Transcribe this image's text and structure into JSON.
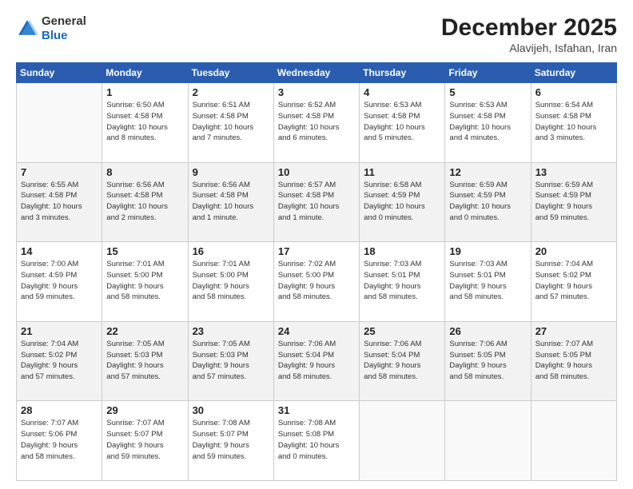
{
  "header": {
    "logo_general": "General",
    "logo_blue": "Blue",
    "main_title": "December 2025",
    "subtitle": "Alavijeh, Isfahan, Iran"
  },
  "weekdays": [
    "Sunday",
    "Monday",
    "Tuesday",
    "Wednesday",
    "Thursday",
    "Friday",
    "Saturday"
  ],
  "rows": [
    {
      "shade": "white",
      "cells": [
        {
          "day": "",
          "info": ""
        },
        {
          "day": "1",
          "info": "Sunrise: 6:50 AM\nSunset: 4:58 PM\nDaylight: 10 hours\nand 8 minutes."
        },
        {
          "day": "2",
          "info": "Sunrise: 6:51 AM\nSunset: 4:58 PM\nDaylight: 10 hours\nand 7 minutes."
        },
        {
          "day": "3",
          "info": "Sunrise: 6:52 AM\nSunset: 4:58 PM\nDaylight: 10 hours\nand 6 minutes."
        },
        {
          "day": "4",
          "info": "Sunrise: 6:53 AM\nSunset: 4:58 PM\nDaylight: 10 hours\nand 5 minutes."
        },
        {
          "day": "5",
          "info": "Sunrise: 6:53 AM\nSunset: 4:58 PM\nDaylight: 10 hours\nand 4 minutes."
        },
        {
          "day": "6",
          "info": "Sunrise: 6:54 AM\nSunset: 4:58 PM\nDaylight: 10 hours\nand 3 minutes."
        }
      ]
    },
    {
      "shade": "shaded",
      "cells": [
        {
          "day": "7",
          "info": "Sunrise: 6:55 AM\nSunset: 4:58 PM\nDaylight: 10 hours\nand 3 minutes."
        },
        {
          "day": "8",
          "info": "Sunrise: 6:56 AM\nSunset: 4:58 PM\nDaylight: 10 hours\nand 2 minutes."
        },
        {
          "day": "9",
          "info": "Sunrise: 6:56 AM\nSunset: 4:58 PM\nDaylight: 10 hours\nand 1 minute."
        },
        {
          "day": "10",
          "info": "Sunrise: 6:57 AM\nSunset: 4:58 PM\nDaylight: 10 hours\nand 1 minute."
        },
        {
          "day": "11",
          "info": "Sunrise: 6:58 AM\nSunset: 4:59 PM\nDaylight: 10 hours\nand 0 minutes."
        },
        {
          "day": "12",
          "info": "Sunrise: 6:59 AM\nSunset: 4:59 PM\nDaylight: 10 hours\nand 0 minutes."
        },
        {
          "day": "13",
          "info": "Sunrise: 6:59 AM\nSunset: 4:59 PM\nDaylight: 9 hours\nand 59 minutes."
        }
      ]
    },
    {
      "shade": "white",
      "cells": [
        {
          "day": "14",
          "info": "Sunrise: 7:00 AM\nSunset: 4:59 PM\nDaylight: 9 hours\nand 59 minutes."
        },
        {
          "day": "15",
          "info": "Sunrise: 7:01 AM\nSunset: 5:00 PM\nDaylight: 9 hours\nand 58 minutes."
        },
        {
          "day": "16",
          "info": "Sunrise: 7:01 AM\nSunset: 5:00 PM\nDaylight: 9 hours\nand 58 minutes."
        },
        {
          "day": "17",
          "info": "Sunrise: 7:02 AM\nSunset: 5:00 PM\nDaylight: 9 hours\nand 58 minutes."
        },
        {
          "day": "18",
          "info": "Sunrise: 7:03 AM\nSunset: 5:01 PM\nDaylight: 9 hours\nand 58 minutes."
        },
        {
          "day": "19",
          "info": "Sunrise: 7:03 AM\nSunset: 5:01 PM\nDaylight: 9 hours\nand 58 minutes."
        },
        {
          "day": "20",
          "info": "Sunrise: 7:04 AM\nSunset: 5:02 PM\nDaylight: 9 hours\nand 57 minutes."
        }
      ]
    },
    {
      "shade": "shaded",
      "cells": [
        {
          "day": "21",
          "info": "Sunrise: 7:04 AM\nSunset: 5:02 PM\nDaylight: 9 hours\nand 57 minutes."
        },
        {
          "day": "22",
          "info": "Sunrise: 7:05 AM\nSunset: 5:03 PM\nDaylight: 9 hours\nand 57 minutes."
        },
        {
          "day": "23",
          "info": "Sunrise: 7:05 AM\nSunset: 5:03 PM\nDaylight: 9 hours\nand 57 minutes."
        },
        {
          "day": "24",
          "info": "Sunrise: 7:06 AM\nSunset: 5:04 PM\nDaylight: 9 hours\nand 58 minutes."
        },
        {
          "day": "25",
          "info": "Sunrise: 7:06 AM\nSunset: 5:04 PM\nDaylight: 9 hours\nand 58 minutes."
        },
        {
          "day": "26",
          "info": "Sunrise: 7:06 AM\nSunset: 5:05 PM\nDaylight: 9 hours\nand 58 minutes."
        },
        {
          "day": "27",
          "info": "Sunrise: 7:07 AM\nSunset: 5:05 PM\nDaylight: 9 hours\nand 58 minutes."
        }
      ]
    },
    {
      "shade": "white",
      "cells": [
        {
          "day": "28",
          "info": "Sunrise: 7:07 AM\nSunset: 5:06 PM\nDaylight: 9 hours\nand 58 minutes."
        },
        {
          "day": "29",
          "info": "Sunrise: 7:07 AM\nSunset: 5:07 PM\nDaylight: 9 hours\nand 59 minutes."
        },
        {
          "day": "30",
          "info": "Sunrise: 7:08 AM\nSunset: 5:07 PM\nDaylight: 9 hours\nand 59 minutes."
        },
        {
          "day": "31",
          "info": "Sunrise: 7:08 AM\nSunset: 5:08 PM\nDaylight: 10 hours\nand 0 minutes."
        },
        {
          "day": "",
          "info": ""
        },
        {
          "day": "",
          "info": ""
        },
        {
          "day": "",
          "info": ""
        }
      ]
    }
  ]
}
